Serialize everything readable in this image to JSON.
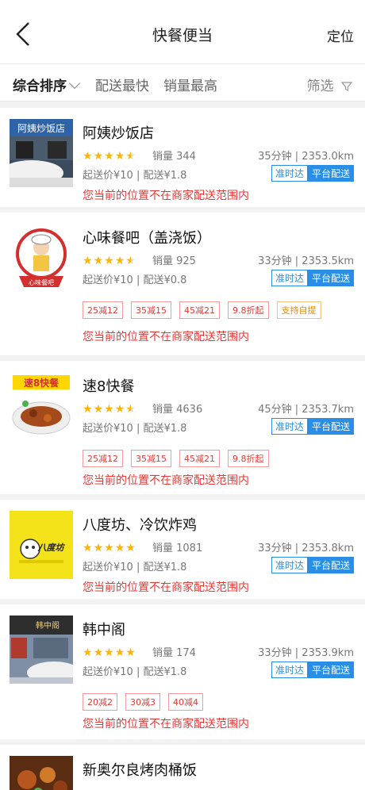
{
  "header": {
    "title": "快餐便当",
    "locate": "定位"
  },
  "sortbar": {
    "items": [
      "综合排序",
      "配送最快",
      "销量最高"
    ],
    "filter": "筛选"
  },
  "colors": {
    "accent": "#2a8ee6",
    "warn": "#e53935",
    "star": "#ffb400"
  },
  "shops": [
    {
      "name": "阿姨炒饭店",
      "rating": 4.5,
      "sales": "销量 344",
      "dist": "35分钟 | 2353.0km",
      "price": "起送价¥10 | 配送¥1.8",
      "badge1": "准时达",
      "badge2": "平台配送",
      "promos": [],
      "warn": "您当前的位置不在商家配送范围内"
    },
    {
      "name": "心味餐吧（盖浇饭）",
      "rating": 4.5,
      "sales": "销量 925",
      "dist": "33分钟 | 2353.5km",
      "price": "起送价¥10 | 配送¥0.8",
      "badge1": "准时达",
      "badge2": "平台配送",
      "promos": [
        "25减12",
        "35减15",
        "45减21",
        "9.8折起",
        "支持自提"
      ],
      "warn": "您当前的位置不在商家配送范围内"
    },
    {
      "name": "速8快餐",
      "rating": 4.5,
      "sales": "销量 4636",
      "dist": "45分钟 | 2353.7km",
      "price": "起送价¥10 | 配送¥1.8",
      "badge1": "准时达",
      "badge2": "平台配送",
      "promos": [
        "25减12",
        "35减15",
        "45减21",
        "9.8折起"
      ],
      "warn": "您当前的位置不在商家配送范围内"
    },
    {
      "name": "八度坊、冷饮炸鸡",
      "rating": 5,
      "sales": "销量 1081",
      "dist": "33分钟 | 2353.8km",
      "price": "起送价¥10 | 配送¥1.8",
      "badge1": "准时达",
      "badge2": "平台配送",
      "promos": [],
      "warn": "您当前的位置不在商家配送范围内"
    },
    {
      "name": "韩中阁",
      "rating": 5,
      "sales": "销量 174",
      "dist": "33分钟 | 2353.9km",
      "price": "起送价¥10 | 配送¥1.8",
      "badge1": "准时达",
      "badge2": "平台配送",
      "promos": [
        "20减2",
        "30减3",
        "40减4"
      ],
      "warn": "您当前的位置不在商家配送范围内"
    },
    {
      "name": "新奥尔良烤肉桶饭"
    }
  ],
  "logos": {
    "shop1": "阿姨炒饭店",
    "shop2": "心味餐吧",
    "shop3": "速8快餐",
    "shop4": "八度坊",
    "shop5": "韩中阁"
  }
}
